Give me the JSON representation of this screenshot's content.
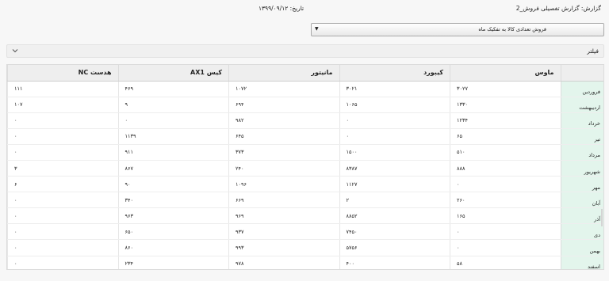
{
  "header": {
    "title": "گزارش: گزارش تفصیلی فروش_2",
    "date": "تاریخ: ۱۳۹۹/۰۹/۱۲"
  },
  "report_select": {
    "value": "فروش تعدادی کالا به تفکیک ماه",
    "icon": "caret-down-icon"
  },
  "filter": {
    "label": "فیلتر",
    "icon": "chevron-down-icon"
  },
  "table": {
    "columns": [
      "ماوس",
      "کیبورد",
      "مانیتور",
      "کیس AX1",
      "هدست NC"
    ],
    "rows": [
      {
        "month": "فروردین",
        "values": [
          "۳۰۲۷",
          "۳۰۲۱",
          "۱۰۷۲",
          "۴۶۹",
          "۱۱۱"
        ]
      },
      {
        "month": "اردیبهشت",
        "values": [
          "۱۳۳۰",
          "۱۰۶۵",
          "۶۹۴",
          "۹",
          "۱۰۷"
        ]
      },
      {
        "month": "خرداد",
        "values": [
          "۱۲۳۴",
          "۰",
          "۹۸۲",
          "۰",
          "۰"
        ]
      },
      {
        "month": "تیر",
        "values": [
          "۶۵",
          "۰",
          "۶۴۵",
          "۱۱۳۹",
          "۰"
        ]
      },
      {
        "month": "مرداد",
        "values": [
          "۵۱۰",
          "۱۵۰۰",
          "۳۷۳",
          "۹۱۱",
          "۰"
        ]
      },
      {
        "month": "شهریور",
        "values": [
          "۸۸۸",
          "۸۳۸۷",
          "۲۴۰",
          "۸۶۷",
          "۳"
        ]
      },
      {
        "month": "مهر",
        "values": [
          "۰",
          "۱۱۲۷",
          "۱۰۹۶",
          "۹۰",
          "۶"
        ]
      },
      {
        "month": "آبان",
        "values": [
          "۲۶۰",
          "۲",
          "۶۶۹",
          "۳۴۰",
          "۰"
        ]
      },
      {
        "month": "آذر",
        "values": [
          "۱۶۵",
          "۸۸۵۲",
          "۹۶۹",
          "۹۶۳",
          "۰"
        ]
      },
      {
        "month": "دی",
        "values": [
          "۰",
          "۷۴۵۰",
          "۹۳۷",
          "۶۵۰",
          "۰"
        ]
      },
      {
        "month": "بهمن",
        "values": [
          "۰",
          "۵۷۵۶",
          "۹۹۳",
          "۸۶۰",
          "۰"
        ]
      },
      {
        "month": "اسفند",
        "values": [
          "۵۸",
          "۴۰۰",
          "۹۷۸",
          "۲۳۴",
          "۰"
        ]
      }
    ]
  },
  "colors": {
    "month_cell_bg": "#e3f5ec",
    "header_bg": "#eeeeee"
  }
}
